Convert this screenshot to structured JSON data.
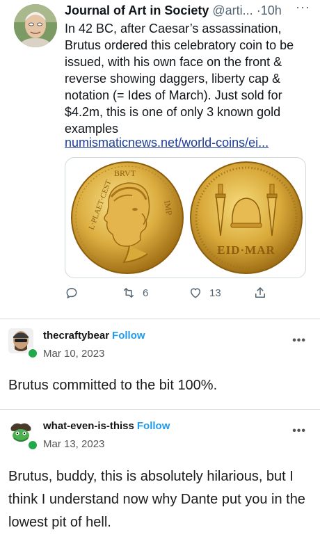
{
  "tweet": {
    "author_name": "Journal of Art in Society",
    "handle": "@arti...",
    "separator": "·",
    "time": "10h",
    "more_icon": "more-horizontal-icon",
    "more_label": "···",
    "text": "In 42 BC, after Caesar’s assassination, Brutus ordered this celebratory coin to be issued, with his own face on the front & reverse showing daggers, liberty cap & notation (= Ides of March). Just sold for $4.2m, this is one of only 3 known gold examples",
    "link": "numismaticnews.net/world-coins/ei...",
    "media": {
      "obverse_inscription": "BRVT IMP L·PLAET·CEST",
      "reverse_inscription": "EID·MAR",
      "colors": {
        "gold_light": "#f3d36a",
        "gold_mid": "#d9a93a",
        "gold_dark": "#9b6a12"
      }
    },
    "actions": {
      "reply_icon": "reply-icon",
      "retweet_icon": "retweet-icon",
      "retweet_count": "6",
      "like_icon": "heart-icon",
      "like_count": "13",
      "share_icon": "share-icon"
    }
  },
  "comments": [
    {
      "username": "thecraftybear",
      "follow_label": "Follow",
      "date": "Mar 10, 2023",
      "more_label": "•••",
      "text": "Brutus committed to the bit 100%."
    },
    {
      "username": "what-even-is-thiss",
      "follow_label": "Follow",
      "date": "Mar 13, 2023",
      "more_label": "•••",
      "text": "Brutus, buddy, this is absolutely hilarious, but I think I understand now why Dante put you in the lowest pit of hell."
    }
  ],
  "colors": {
    "link": "#1d3c9b",
    "follow": "#1d9bf0",
    "badge": "#22a94c",
    "divider": "#cfd9de",
    "secondary_text": "#536471"
  }
}
